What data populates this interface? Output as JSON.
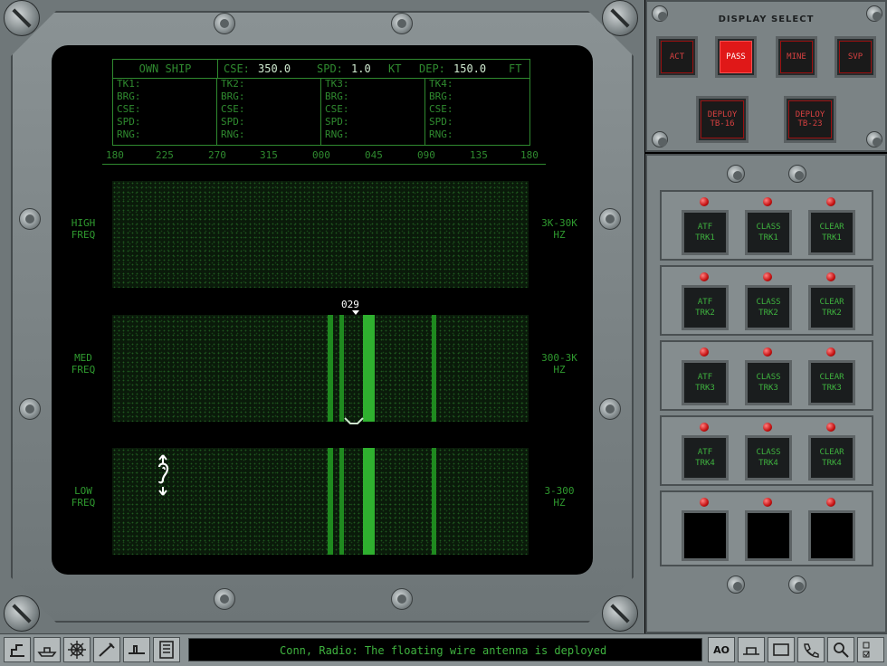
{
  "header": {
    "own_ship_label": "OWN SHIP",
    "cse_label": "CSE:",
    "cse_value": "350.0",
    "spd_label": "SPD:",
    "spd_value": "1.0",
    "spd_unit": "KT",
    "dep_label": "DEP:",
    "dep_value": "150.0",
    "dep_unit": "FT"
  },
  "tracks": [
    {
      "name": "TK1:",
      "fields": [
        "BRG:",
        "CSE:",
        "SPD:",
        "RNG:"
      ]
    },
    {
      "name": "TK2:",
      "fields": [
        "BRG:",
        "CSE:",
        "SPD:",
        "RNG:"
      ]
    },
    {
      "name": "TK3:",
      "fields": [
        "BRG:",
        "CSE:",
        "SPD:",
        "RNG:"
      ]
    },
    {
      "name": "TK4:",
      "fields": [
        "BRG:",
        "CSE:",
        "SPD:",
        "RNG:"
      ]
    }
  ],
  "bearings": [
    "180",
    "225",
    "270",
    "315",
    "000",
    "045",
    "090",
    "135",
    "180"
  ],
  "bands": [
    {
      "left_line1": "HIGH",
      "left_line2": "FREQ",
      "right_line1": "3K-30K",
      "right_line2": "HZ"
    },
    {
      "left_line1": "MED",
      "left_line2": "FREQ",
      "right_line1": "300-3K",
      "right_line2": "HZ"
    },
    {
      "left_line1": "LOW",
      "left_line2": "FREQ",
      "right_line1": "3-300",
      "right_line2": "HZ"
    }
  ],
  "cursor_bearing": "029",
  "display_select": {
    "title": "DISPLAY SELECT",
    "buttons": [
      "ACT",
      "PASS",
      "MINE",
      "SVP"
    ],
    "active": "PASS",
    "deploy": [
      {
        "line1": "DEPLOY",
        "line2": "TB-16"
      },
      {
        "line1": "DEPLOY",
        "line2": "TB-23"
      }
    ]
  },
  "track_groups": [
    {
      "buttons": [
        {
          "l1": "ATF",
          "l2": "TRK1"
        },
        {
          "l1": "CLASS",
          "l2": "TRK1"
        },
        {
          "l1": "CLEAR",
          "l2": "TRK1"
        }
      ]
    },
    {
      "buttons": [
        {
          "l1": "ATF",
          "l2": "TRK2"
        },
        {
          "l1": "CLASS",
          "l2": "TRK2"
        },
        {
          "l1": "CLEAR",
          "l2": "TRK2"
        }
      ]
    },
    {
      "buttons": [
        {
          "l1": "ATF",
          "l2": "TRK3"
        },
        {
          "l1": "CLASS",
          "l2": "TRK3"
        },
        {
          "l1": "CLEAR",
          "l2": "TRK3"
        }
      ]
    },
    {
      "buttons": [
        {
          "l1": "ATF",
          "l2": "TRK4"
        },
        {
          "l1": "CLASS",
          "l2": "TRK4"
        },
        {
          "l1": "CLEAR",
          "l2": "TRK4"
        }
      ]
    },
    {
      "buttons": [
        {
          "l1": "",
          "l2": ""
        },
        {
          "l1": "",
          "l2": ""
        },
        {
          "l1": "",
          "l2": ""
        }
      ]
    }
  ],
  "taskbar": {
    "message": "Conn, Radio: The floating wire antenna is deployed",
    "ao_label": "AO",
    "icons": [
      "periscope-icon",
      "ship-icon",
      "helm-wheel-icon",
      "weapon-icon",
      "sub-icon",
      "panel-icon"
    ]
  },
  "colors": {
    "phosphor": "#3fb33f",
    "active_red": "#e01818",
    "bezel": "#7b8385"
  }
}
